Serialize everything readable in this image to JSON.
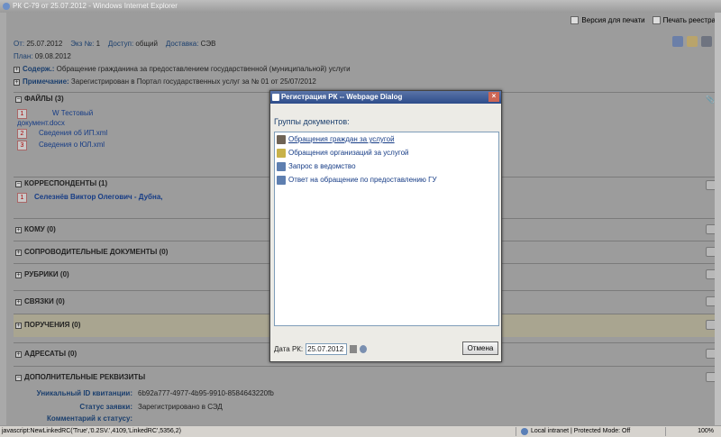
{
  "window": {
    "title": "РК С-79 от 25.07.2012 - Windows Internet Explorer"
  },
  "toolbar": {
    "print_version": "Версия для печати",
    "print_rk": "Печать реестра"
  },
  "header": {
    "from_label": "От:",
    "from_value": "25.07.2012",
    "copy_label": "Экз №:",
    "copy_value": "1",
    "access_label": "Доступ:",
    "access_value": "общий",
    "delivery_label": "Доставка:",
    "delivery_value": "СЭВ",
    "plan_label": "План:",
    "plan_value": "09.08.2012",
    "content_label": "Содерж.:",
    "content_value": "Обращение гражданина за предоставлением государственной (муниципальной) услуги",
    "note_label": "Примечание:",
    "note_value": "Зарегистрирован в Портал государственных услуг за № 01 от 25/07/2012"
  },
  "sections": {
    "files": {
      "title": "ФАЙЛЫ (3)",
      "items": [
        {
          "num": "1",
          "name": "Тестовый",
          "name2": "документ.docx"
        },
        {
          "num": "2",
          "name": "Сведения об ИП.xml"
        },
        {
          "num": "3",
          "name": "Сведения о ЮЛ.xml"
        }
      ]
    },
    "correspondents": {
      "title": "КОРРЕСПОНДЕНТЫ (1)",
      "items": [
        {
          "num": "1",
          "name": "Селезнёв Виктор Олегович - Дубна,"
        }
      ]
    },
    "to_whom": {
      "title": "КОМУ (0)"
    },
    "accompanying": {
      "title": "СОПРОВОДИТЕЛЬНЫЕ ДОКУМЕНТЫ (0)"
    },
    "rubrics": {
      "title": "РУБРИКИ (0)"
    },
    "links": {
      "title": "СВЯЗКИ (0)"
    },
    "assignments": {
      "title": "ПОРУЧЕНИЯ (0)"
    },
    "addressees": {
      "title": "АДРЕСАТЫ (0)"
    },
    "extra": {
      "title": "ДОПОЛНИТЕЛЬНЫЕ РЕКВИЗИТЫ",
      "uid_label": "Уникальный ID квитанции:",
      "uid_value": "6b92a777-4977-4b95-9910-8584643220fb",
      "status_label": "Статус заявки:",
      "status_value": "Зарегистрировано в СЭД",
      "comment_label": "Комментарий к статусу:"
    }
  },
  "dialog": {
    "title": "Регистрация РК -- Webpage Dialog",
    "groups_title": "Группы документов:",
    "items": [
      "Обращения граждан за услугой",
      "Обращения организаций за услугой",
      "Запрос в ведомство",
      "Ответ на обращение по предоставлению ГУ"
    ],
    "date_label": "Дата РК:",
    "date_value": "25.07.2012",
    "cancel_label": "Отмена"
  },
  "status_bar": {
    "text": "javascript:NewLinkedRC('True','0.2SV.',4109,'LinkedRC',5356,2)",
    "zone": "Local intranet | Protected Mode: Off",
    "zoom": "100%"
  },
  "colors": {
    "link": "#163c86",
    "label": "#1b3f6e",
    "dialog_title": "#2d4c8a"
  }
}
